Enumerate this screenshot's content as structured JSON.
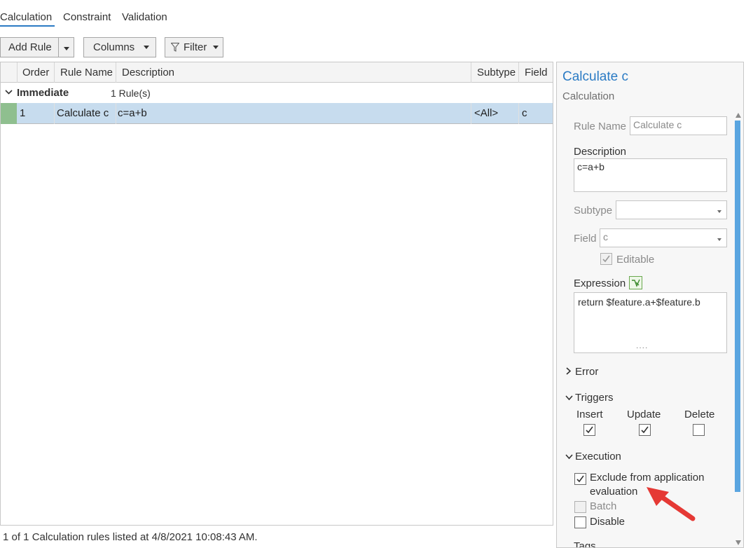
{
  "tabs": [
    {
      "label": "Calculation",
      "active": true
    },
    {
      "label": "Constraint",
      "active": false
    },
    {
      "label": "Validation",
      "active": false
    }
  ],
  "toolbar": {
    "add_rule_label": "Add Rule",
    "columns_label": "Columns",
    "filter_label": "Filter"
  },
  "table": {
    "columns": [
      "Order",
      "Rule Name",
      "Description",
      "Subtype",
      "Field"
    ],
    "group": {
      "label": "Immediate",
      "count": "1 Rule(s)"
    },
    "rows": [
      {
        "order": "1",
        "rule_name": "Calculate c",
        "description": "c=a+b",
        "subtype": "<All>",
        "field": "c"
      }
    ]
  },
  "status": {
    "text": "1 of 1 Calculation rules listed at 4/8/2021 10:08:43 AM."
  },
  "panel": {
    "title": "Calculate c",
    "subtitle": "Calculation",
    "rule_name_label": "Rule Name",
    "rule_name_value": "Calculate c",
    "description_label": "Description",
    "description_value": "c=a+b",
    "subtype_label": "Subtype",
    "subtype_value": "",
    "field_label": "Field",
    "field_value": "c",
    "editable_label": "Editable",
    "editable_checked": true,
    "expression_label": "Expression",
    "expression_value": "return $feature.a+$feature.b",
    "expression_resize": "....",
    "error_label": "Error",
    "triggers_label": "Triggers",
    "insert_label": "Insert",
    "update_label": "Update",
    "delete_label": "Delete",
    "insert_checked": true,
    "update_checked": true,
    "delete_checked": false,
    "execution_label": "Execution",
    "exclude_label_line1": "Exclude from application",
    "exclude_label_line2": "evaluation",
    "exclude_checked": true,
    "batch_label": "Batch",
    "batch_checked": false,
    "disable_label": "Disable",
    "disable_checked": false,
    "tags_label": "Tags"
  },
  "colors": {
    "accent": "#2b7bc4",
    "selected_row": "#c7dcee",
    "arrow": "#e53935"
  }
}
